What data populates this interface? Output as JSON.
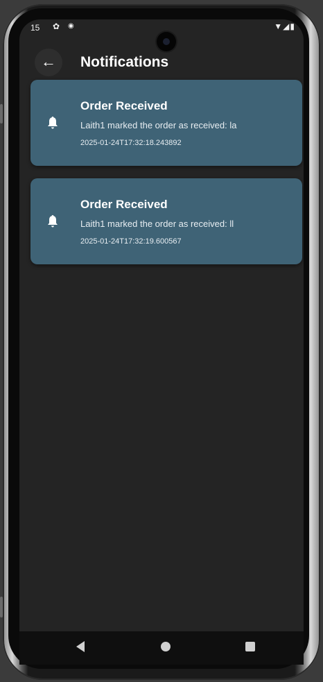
{
  "status_bar": {
    "time": "15",
    "left_icons": [
      "gear-icon",
      "shield-dot-icon"
    ],
    "right_icons": [
      "wifi-icon",
      "signal-icon",
      "battery-icon"
    ]
  },
  "app_bar": {
    "title": "Notifications",
    "back_icon": "arrow-left-icon"
  },
  "notifications": [
    {
      "icon": "bell-icon",
      "title": "Order Received",
      "message": "Laith1 marked the order as received: la",
      "timestamp": "2025-01-24T17:32:18.243892"
    },
    {
      "icon": "bell-icon",
      "title": "Order Received",
      "message": "Laith1 marked the order as received: ll",
      "timestamp": "2025-01-24T17:32:19.600567"
    }
  ],
  "nav_bar": {
    "buttons": [
      "back-triangle-icon",
      "home-circle-icon",
      "recents-square-icon"
    ]
  },
  "colors": {
    "screen_bg": "#242424",
    "card_bg": "#3f6376",
    "text": "#ffffff"
  }
}
